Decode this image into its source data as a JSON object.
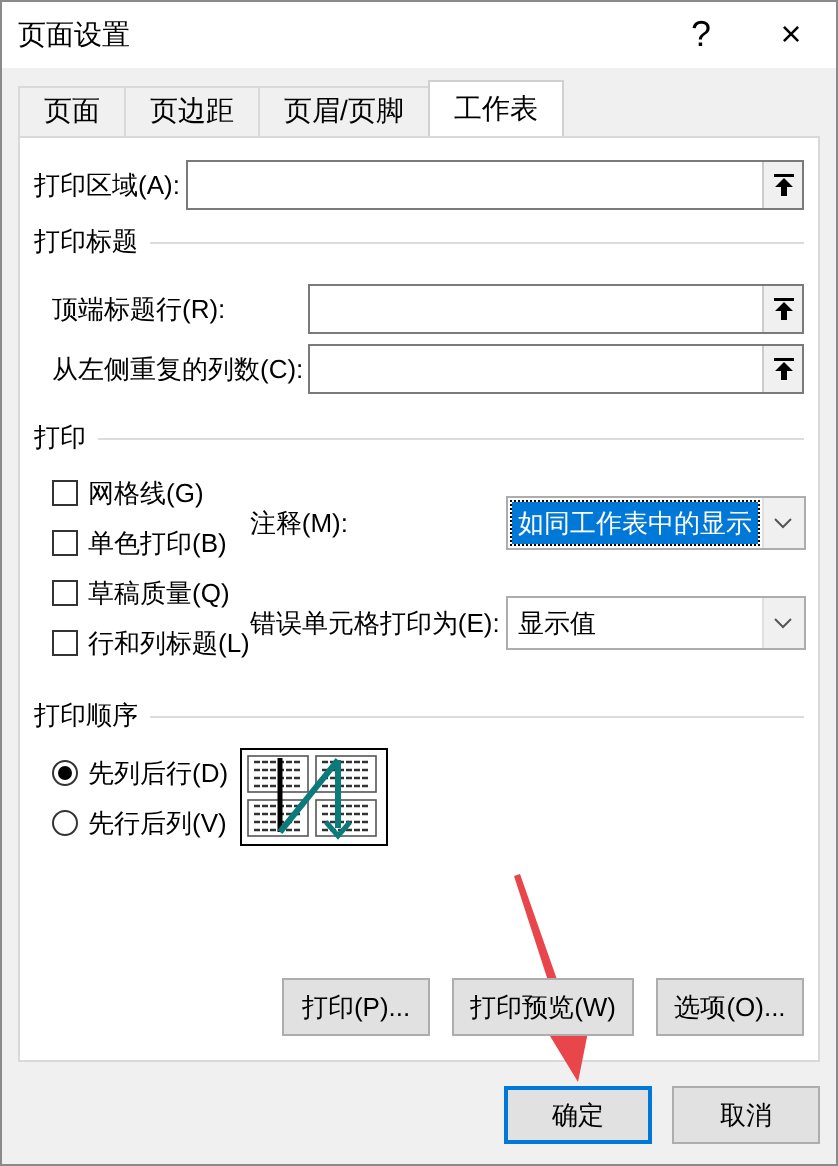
{
  "window": {
    "title": "页面设置",
    "help_button": "?",
    "close_button": "×"
  },
  "tabs": [
    {
      "label": "页面",
      "selected": false
    },
    {
      "label": "页边距",
      "selected": false
    },
    {
      "label": "页眉/页脚",
      "selected": false
    },
    {
      "label": "工作表",
      "selected": true
    }
  ],
  "print_area": {
    "label": "打印区域(A):"
  },
  "print_titles": {
    "heading": "打印标题",
    "fields": [
      {
        "label": "顶端标题行(R):"
      },
      {
        "label": "从左侧重复的列数(C):"
      }
    ]
  },
  "print": {
    "heading": "打印",
    "options": [
      {
        "label": "网格线(G)",
        "checked": false
      },
      {
        "label": "单色打印(B)",
        "checked": false
      },
      {
        "label": "草稿质量(Q)",
        "checked": false
      },
      {
        "label": "行和列标题(L)",
        "checked": false
      }
    ],
    "comments": {
      "label": "注释(M):",
      "value": "如同工作表中的显示",
      "highlighted": true
    },
    "cell_errors": {
      "label": "错误单元格打印为(E):",
      "value": "显示值",
      "highlighted": false
    }
  },
  "page_order": {
    "heading": "打印顺序",
    "options": [
      {
        "label": "先列后行(D)",
        "selected": true
      },
      {
        "label": "先行后列(V)",
        "selected": false
      }
    ]
  },
  "panel_buttons": [
    "打印(P)...",
    "打印预览(W)",
    "选项(O)..."
  ],
  "dialog_buttons": [
    {
      "label": "确定",
      "default": true
    },
    {
      "label": "取消",
      "default": false
    }
  ]
}
